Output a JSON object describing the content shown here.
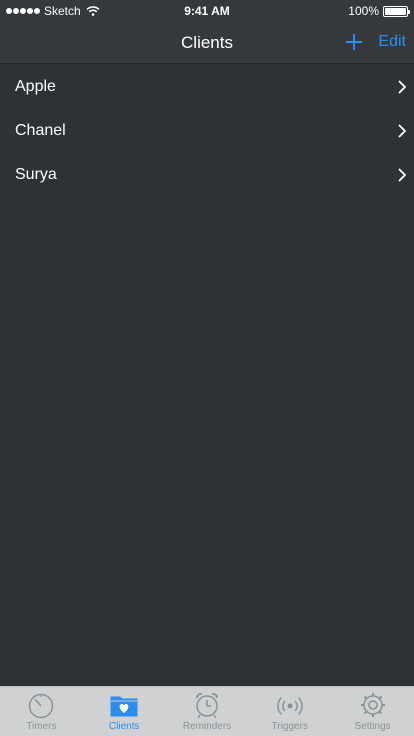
{
  "status_bar": {
    "carrier": "Sketch",
    "time": "9:41 AM",
    "battery": "100%"
  },
  "nav": {
    "title": "Clients",
    "edit_label": "Edit"
  },
  "clients": [
    {
      "label": "Apple"
    },
    {
      "label": "Chanel"
    },
    {
      "label": "Surya"
    }
  ],
  "tabs": [
    {
      "label": "Timers",
      "icon": "timer-icon",
      "active": false
    },
    {
      "label": "Clients",
      "icon": "folder-heart-icon",
      "active": true
    },
    {
      "label": "Reminders",
      "icon": "alarm-clock-icon",
      "active": false
    },
    {
      "label": "Triggers",
      "icon": "broadcast-icon",
      "active": false
    },
    {
      "label": "Settings",
      "icon": "gear-icon",
      "active": false
    }
  ],
  "colors": {
    "accent": "#2d8cf0",
    "background": "#2f3234",
    "bar": "#36393b",
    "tab_bar": "#cfd1d2",
    "inactive_tab": "#8e9193"
  }
}
